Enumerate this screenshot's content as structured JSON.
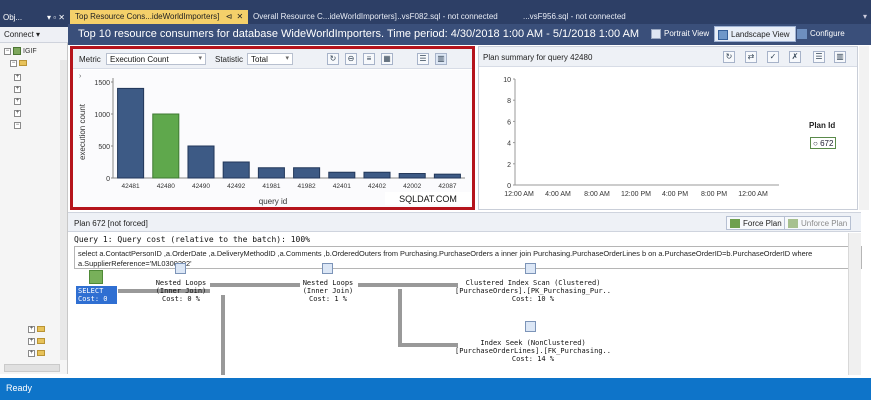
{
  "object_explorer": {
    "title": "Obj...",
    "header_icons": "▾ ▫ ✕",
    "connect_label": "Connect ▾",
    "server_label": "IGIF"
  },
  "tabs": [
    {
      "label": "Top Resource Cons...ideWorldImporters]"
    },
    {
      "label": "Overall Resource C...ideWorldImporters]"
    },
    {
      "label": "...vsF082.sql - not connected"
    },
    {
      "label": "...vsF956.sql - not connected"
    }
  ],
  "tab_pin": "⊲",
  "tab_close": "✕",
  "report": {
    "title": "Top 10 resource consumers for database WideWorldImporters. Time period: 4/30/2018 1:00 AM - 5/1/2018 1:00 AM",
    "portrait_label": "Portrait View",
    "landscape_label": "Landscape View",
    "configure_label": "Configure"
  },
  "left_panel": {
    "metric_label": "Metric",
    "metric_value": "Execution Count",
    "statistic_label": "Statistic",
    "statistic_value": "Total"
  },
  "chart_data": {
    "type": "bar",
    "categories": [
      "42481",
      "42480",
      "42490",
      "42492",
      "41981",
      "41982",
      "42401",
      "42402",
      "42002",
      "42087"
    ],
    "values": [
      1400,
      1000,
      500,
      250,
      160,
      160,
      90,
      90,
      70,
      60
    ],
    "xlabel": "query id",
    "ylabel": "execution count",
    "y_ticks": [
      "1500",
      "1000",
      "500",
      "0"
    ],
    "ylim": [
      0,
      1500
    ],
    "selected_index": 1,
    "watermark": "SQLDAT.COM"
  },
  "right_panel": {
    "title": "Plan summary for query 42480",
    "y_ticks": [
      "10",
      "8",
      "6",
      "4",
      "2",
      "0"
    ],
    "x_ticks": [
      "12:00 AM",
      "4:00 AM",
      "8:00 AM",
      "12:00 PM",
      "4:00 PM",
      "8:00 PM",
      "12:00 AM"
    ],
    "legend_title": "Plan Id",
    "legend_item": "672"
  },
  "plan": {
    "header": "Plan 672 [not forced]",
    "force_label": "Force Plan",
    "unforce_label": "Unforce Plan",
    "query_line": "Query 1: Query cost (relative to the batch): 100%",
    "sql_tip_1": "select  a.ContactPersonID ,a.OrderDate ,a.DeliveryMethodID ,a.Comments ,b.OrderedOuters  from Purchasing.PurchaseOrders a inner join Purchasing.PurchaseOrderLines b on a.PurchaseOrderID=b.PurchaseOrderID where",
    "sql_tip_2": "a.SupplierReference='ML0300202'",
    "select_1": "SELECT",
    "select_2": "Cost: 0 %",
    "nl1_1": "Nested Loops",
    "nl1_2": "(Inner Join)",
    "nl1_3": "Cost: 0 %",
    "nl2_1": "Nested Loops",
    "nl2_2": "(Inner Join)",
    "nl2_3": "Cost: 1 %",
    "cis_1": "Clustered Index Scan (Clustered)",
    "cis_2": "[PurchaseOrders].[PK_Purchasing_Pur..",
    "cis_3": "Cost: 10 %",
    "is_1": "Index Seek (NonClustered)",
    "is_2": "[PurchaseOrderLines].[FK_Purchasing..",
    "is_3": "Cost: 14 %"
  },
  "status": {
    "text": "Ready"
  },
  "colors": {
    "accent": "#b5141c",
    "bar_fill": "#3d5a85",
    "bar_selected": "#5fa84c",
    "status_bar": "#0e74c9"
  }
}
